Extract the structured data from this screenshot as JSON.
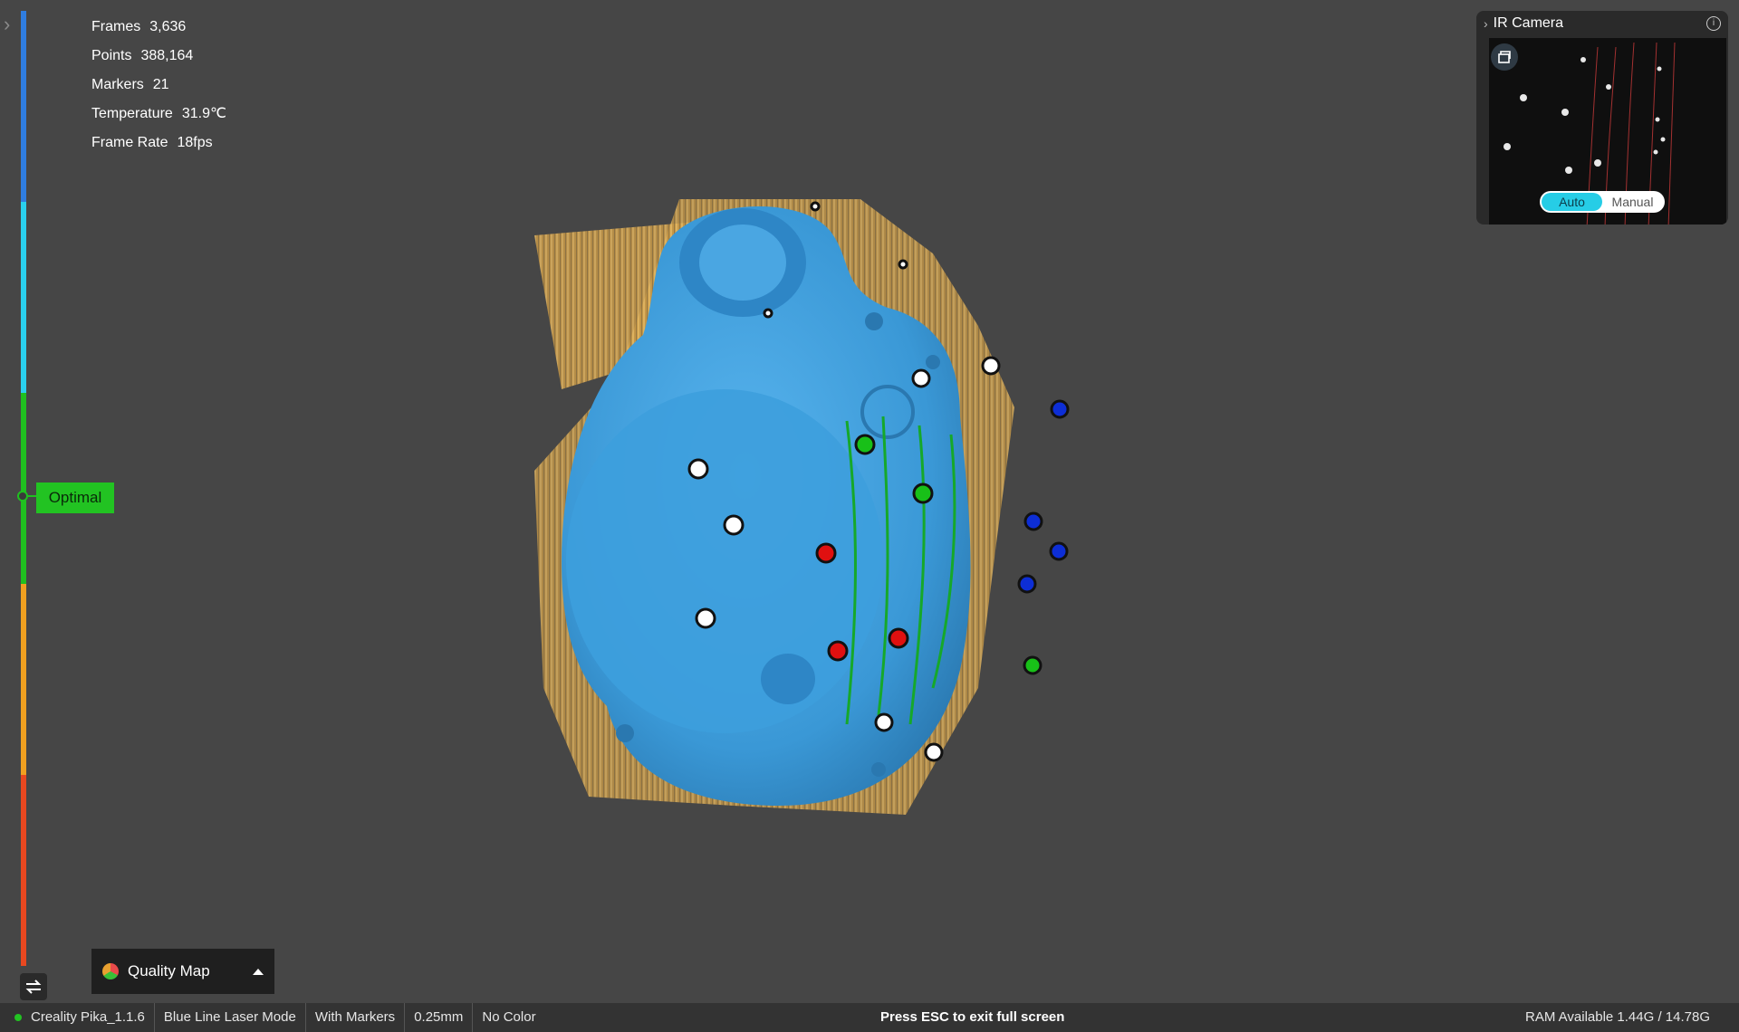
{
  "stats": [
    {
      "label": "Frames",
      "value": "3,636"
    },
    {
      "label": "Points",
      "value": "388,164"
    },
    {
      "label": "Markers",
      "value": "21"
    },
    {
      "label": "Temperature",
      "value": "31.9℃"
    },
    {
      "label": "Frame Rate",
      "value": "18fps"
    }
  ],
  "distance_bar": {
    "colors": [
      "#2f7de0",
      "#2ad0ee",
      "#20c020",
      "#f0a020",
      "#e84820"
    ],
    "current_label": "Optimal",
    "current_color": "#22c322"
  },
  "ir_camera": {
    "title": "IR Camera",
    "mode_options": [
      "Auto",
      "Manual"
    ],
    "selected_mode": "Auto"
  },
  "quality_map": {
    "label": "Quality Map"
  },
  "status_bar": {
    "app": "Creality Pika_1.1.6",
    "mode": "Blue Line Laser Mode",
    "markers": "With Markers",
    "resolution": "0.25mm",
    "color": "No Color",
    "hint": "Press ESC to exit full screen",
    "ram": "RAM Available 1.44G / 14.78G"
  },
  "colors": {
    "background": "#464646",
    "scan_blue": "#3a98d6",
    "overscan_gold": "#d9a54a",
    "marker_green": "#18c018",
    "marker_red": "#e01010",
    "marker_blue": "#0d2ed6",
    "accent_cyan": "#26cde6"
  }
}
